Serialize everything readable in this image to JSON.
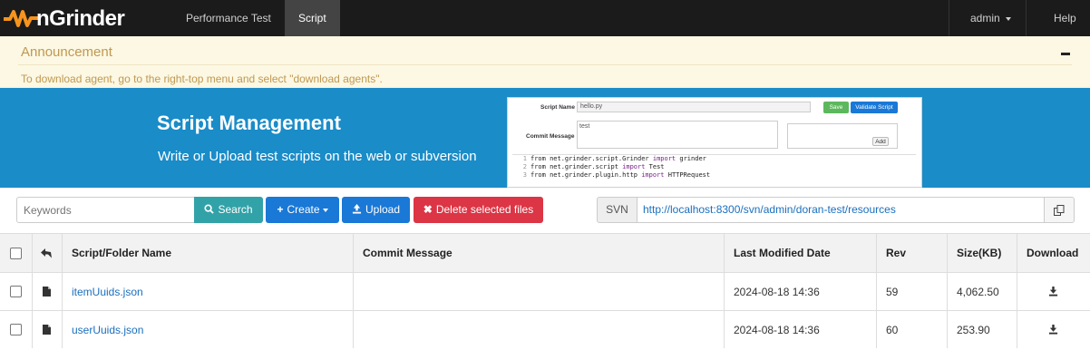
{
  "navbar": {
    "brand": "nGrinder",
    "items": [
      {
        "label": "Performance Test",
        "active": false
      },
      {
        "label": "Script",
        "active": true
      }
    ],
    "user_menu": "admin",
    "help": "Help"
  },
  "announcement": {
    "title": "Announcement",
    "text": "To download agent, go to the right-top menu and select \"download agents\"."
  },
  "banner": {
    "title": "Script Management",
    "subtitle": "Write or Upload test scripts on the web or subversion",
    "preview": {
      "script_name_label": "Script Name",
      "script_name_value": "hello.py",
      "save_label": "Save",
      "validate_label": "Validate Script",
      "commit_label": "Commit Message",
      "commit_value": "test",
      "add_label": "Add",
      "code_lines": [
        {
          "num": "1",
          "pre": "from net.grinder.script.Grinder ",
          "kw": "import",
          "post": " grinder"
        },
        {
          "num": "2",
          "pre": "from net.grinder.script ",
          "kw": "import",
          "post": " Test"
        },
        {
          "num": "3",
          "pre": "from net.grinder.plugin.http ",
          "kw": "import",
          "post": " HTTPRequest"
        }
      ]
    }
  },
  "toolbar": {
    "keyword_placeholder": "Keywords",
    "search_label": "Search",
    "create_label": "Create",
    "upload_label": "Upload",
    "delete_label": "Delete selected files",
    "svn_label": "SVN",
    "svn_url": "http://localhost:8300/svn/admin/doran-test/resources"
  },
  "table": {
    "headers": {
      "name": "Script/Folder Name",
      "commit": "Commit Message",
      "modified": "Last Modified Date",
      "rev": "Rev",
      "size": "Size(KB)",
      "download": "Download"
    },
    "rows": [
      {
        "name": "itemUuids.json",
        "commit": "",
        "modified": "2024-08-18 14:36",
        "rev": "59",
        "size": "4,062.50"
      },
      {
        "name": "userUuids.json",
        "commit": "",
        "modified": "2024-08-18 14:36",
        "rev": "60",
        "size": "253.90"
      }
    ]
  },
  "colors": {
    "navbar": "#1b1b1b",
    "brand_accent": "#f7941d",
    "announcement_bg": "#fcf8e3",
    "banner_bg": "#1a8cc8",
    "primary": "#1a78d6",
    "search": "#31a2a8",
    "danger": "#dc3545",
    "link": "#1a6fbf"
  }
}
